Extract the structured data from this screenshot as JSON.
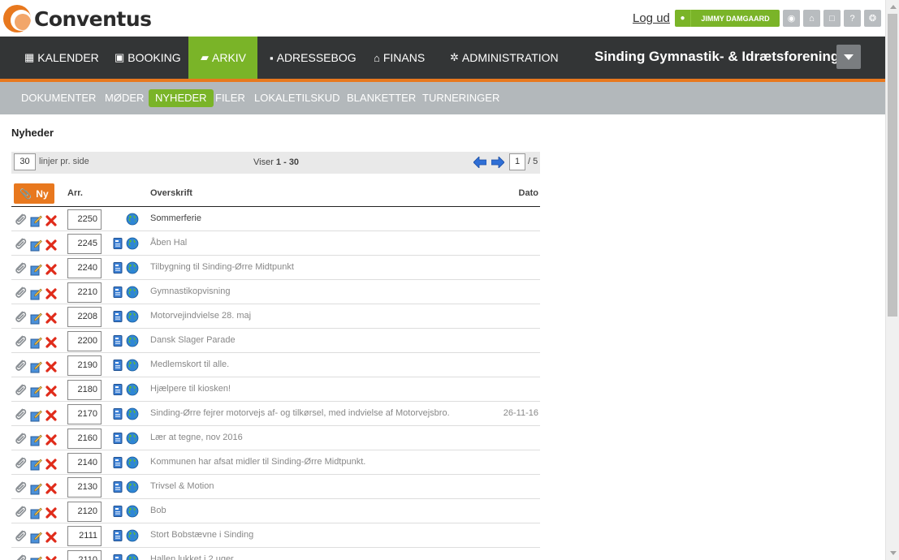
{
  "brand": {
    "name": "Conventus",
    "accent": "#e8781e",
    "green": "#7ab428"
  },
  "header": {
    "logout": "Log ud",
    "user": "JIMMY DAMGAARD",
    "tools": [
      "chat-icon",
      "bank-icon",
      "monitor-icon",
      "help-icon",
      "gear-icon"
    ]
  },
  "nav": {
    "items": [
      {
        "label": "KALENDER",
        "icon": "calendar-icon",
        "glyph": "▦"
      },
      {
        "label": "BOOKING",
        "icon": "booking-icon",
        "glyph": "▣"
      },
      {
        "label": "ARKIV",
        "icon": "folder-icon",
        "glyph": "▰",
        "active": true
      },
      {
        "label": "ADRESSEBOG",
        "icon": "addressbook-icon",
        "glyph": "▪"
      },
      {
        "label": "FINANS",
        "icon": "bank-icon",
        "glyph": "⌂"
      },
      {
        "label": "ADMINISTRATION",
        "icon": "gear-icon",
        "glyph": "✲"
      }
    ],
    "org": "Sinding Gymnastik- & Idrætsforening"
  },
  "subnav": {
    "items": [
      {
        "label": "DOKUMENTER"
      },
      {
        "label": "MØDER"
      },
      {
        "label": "NYHEDER",
        "active": true
      },
      {
        "label": "FILER"
      },
      {
        "label": "LOKALETILSKUD"
      },
      {
        "label": "BLANKETTER"
      },
      {
        "label": "TURNERINGER"
      }
    ]
  },
  "page": {
    "title": "Nyheder"
  },
  "pager": {
    "lines_value": "30",
    "lines_label": "linjer pr. side",
    "showing_prefix": "Viser ",
    "showing_range": "1 - 30",
    "page_value": "1",
    "page_total": "/ 5"
  },
  "table": {
    "new_label": "Ny",
    "col_arr": "Arr.",
    "col_headline": "Overskrift",
    "col_date": "Dato",
    "rows": [
      {
        "arr": "2250",
        "headline": "Sommerferie",
        "date": "",
        "doc": false
      },
      {
        "arr": "2245",
        "headline": "Åben Hal",
        "date": "",
        "doc": true
      },
      {
        "arr": "2240",
        "headline": "Tilbygning til Sinding-Ørre Midtpunkt",
        "date": "",
        "doc": true
      },
      {
        "arr": "2210",
        "headline": "Gymnastikopvisning",
        "date": "",
        "doc": true
      },
      {
        "arr": "2208",
        "headline": "Motorvejindvielse 28. maj",
        "date": "",
        "doc": true
      },
      {
        "arr": "2200",
        "headline": "Dansk Slager Parade",
        "date": "",
        "doc": true
      },
      {
        "arr": "2190",
        "headline": "Medlemskort til alle.",
        "date": "",
        "doc": true
      },
      {
        "arr": "2180",
        "headline": "Hjælpere til kiosken!",
        "date": "",
        "doc": true
      },
      {
        "arr": "2170",
        "headline": "Sinding-Ørre fejrer motorvejs af- og tilkørsel, med indvielse af Motorvejsbro.",
        "date": "26-11-16",
        "doc": true
      },
      {
        "arr": "2160",
        "headline": "Lær at tegne, nov 2016",
        "date": "",
        "doc": true
      },
      {
        "arr": "2140",
        "headline": "Kommunen har afsat midler til Sinding-Ørre Midtpunkt.",
        "date": "",
        "doc": true
      },
      {
        "arr": "2130",
        "headline": "Trivsel & Motion",
        "date": "",
        "doc": true
      },
      {
        "arr": "2120",
        "headline": "Bob",
        "date": "",
        "doc": true
      },
      {
        "arr": "2111",
        "headline": "Stort Bobstævne i Sinding",
        "date": "",
        "doc": true
      },
      {
        "arr": "2110",
        "headline": "Hallen lukket i 2 uger",
        "date": "",
        "doc": true
      }
    ]
  }
}
